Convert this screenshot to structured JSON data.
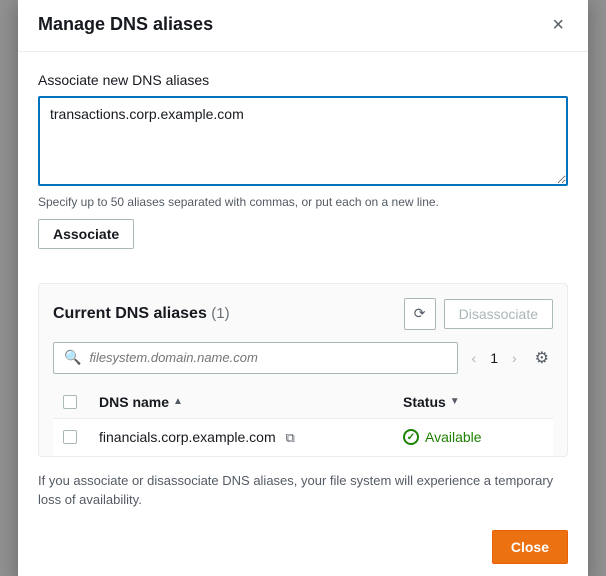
{
  "modal": {
    "title": "Manage DNS aliases",
    "close_label": "×"
  },
  "associate_section": {
    "label": "Associate new DNS aliases",
    "textarea_value": "transactions.corp.example.com",
    "helper_text": "Specify up to 50 aliases separated with commas, or put each on a new line.",
    "associate_btn_label": "Associate"
  },
  "current_section": {
    "title": "Current DNS aliases",
    "count": "(1)",
    "disassociate_btn_label": "Disassociate",
    "search_placeholder": "filesystem.domain.name.com",
    "page_number": "1",
    "table": {
      "headers": [
        "DNS name",
        "Status"
      ],
      "rows": [
        {
          "dns_name": "financials.corp.example.com",
          "status": "Available"
        }
      ]
    }
  },
  "footer_note": "If you associate or disassociate DNS aliases, your file system will experience a temporary loss of availability.",
  "close_btn_label": "Close"
}
